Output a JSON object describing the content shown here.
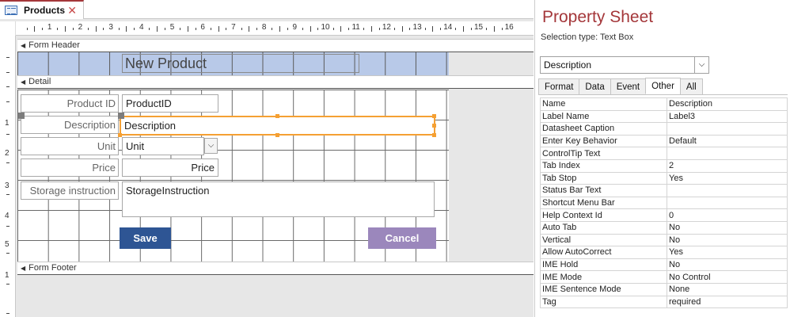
{
  "document_tab": {
    "label": "Products",
    "close_glyph": "✕"
  },
  "ruler": {
    "numbers": [
      "1",
      "2",
      "3",
      "4",
      "5",
      "6",
      "7",
      "8",
      "9",
      "10",
      "11",
      "12",
      "13",
      "14",
      "15",
      "16"
    ],
    "vertical_numbers": [
      "1",
      "2",
      "3",
      "4",
      "5",
      "1"
    ]
  },
  "sections": {
    "header": "Form Header",
    "detail": "Detail",
    "footer": "Form Footer"
  },
  "form": {
    "title": "New Product",
    "labels": [
      "Product ID",
      "Description",
      "Unit",
      "Price",
      "Storage instruction"
    ],
    "fields": {
      "product_id": "ProductID",
      "description": "Description",
      "unit": "Unit",
      "price": "Price",
      "storage": "StorageInstruction"
    },
    "save_label": "Save",
    "cancel_label": "Cancel"
  },
  "property_sheet": {
    "title": "Property Sheet",
    "selection_type": "Selection type:  Text Box",
    "combo_value": "Description",
    "tabs": [
      "Format",
      "Data",
      "Event",
      "Other",
      "All"
    ],
    "active_tab": "Other",
    "rows": [
      [
        "Name",
        "Description"
      ],
      [
        "Label Name",
        "Label3"
      ],
      [
        "Datasheet Caption",
        ""
      ],
      [
        "Enter Key Behavior",
        "Default"
      ],
      [
        "ControlTip Text",
        ""
      ],
      [
        "Tab Index",
        "2"
      ],
      [
        "Tab Stop",
        "Yes"
      ],
      [
        "Status Bar Text",
        ""
      ],
      [
        "Shortcut Menu Bar",
        ""
      ],
      [
        "Help Context Id",
        "0"
      ],
      [
        "Auto Tab",
        "No"
      ],
      [
        "Vertical",
        "No"
      ],
      [
        "Allow AutoCorrect",
        "Yes"
      ],
      [
        "IME Hold",
        "No"
      ],
      [
        "IME Mode",
        "No Control"
      ],
      [
        "IME Sentence Mode",
        "None"
      ],
      [
        "Tag",
        "required"
      ]
    ]
  },
  "colors": {
    "accent": "#a4373a",
    "header_band": "#b8c9e8",
    "selection": "#f5a033",
    "save": "#2e5594",
    "cancel": "#9b87bc"
  }
}
